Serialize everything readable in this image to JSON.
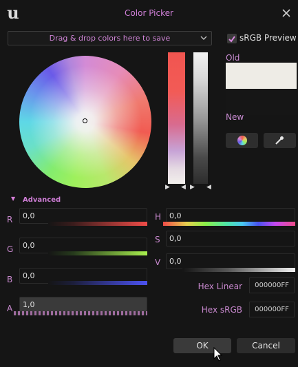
{
  "window": {
    "title": "Color Picker",
    "logo_glyph": "u",
    "close_icon": "close-icon"
  },
  "dropzone": {
    "label": "Drag & drop colors here to save"
  },
  "srgb_preview": {
    "label": "sRGB Preview",
    "checked": true
  },
  "swatches": {
    "old_label": "Old",
    "new_label": "New",
    "old_color": "#eeece6",
    "new_color": "#161616"
  },
  "advanced": {
    "label": "Advanced"
  },
  "channels": {
    "r": {
      "label": "R",
      "value": "0,0"
    },
    "g": {
      "label": "G",
      "value": "0,0"
    },
    "b": {
      "label": "B",
      "value": "0,0"
    },
    "a": {
      "label": "A",
      "value": "1,0"
    },
    "h": {
      "label": "H",
      "value": "0,0"
    },
    "s": {
      "label": "S",
      "value": "0,0"
    },
    "v": {
      "label": "V",
      "value": "0,0"
    }
  },
  "hex": {
    "linear_label": "Hex Linear",
    "linear_value": "000000FF",
    "srgb_label": "Hex sRGB",
    "srgb_value": "000000FF"
  },
  "buttons": {
    "ok": "OK",
    "cancel": "Cancel"
  },
  "colors": {
    "accent": "#cf7ed6",
    "background": "#151515",
    "field": "#151515"
  }
}
